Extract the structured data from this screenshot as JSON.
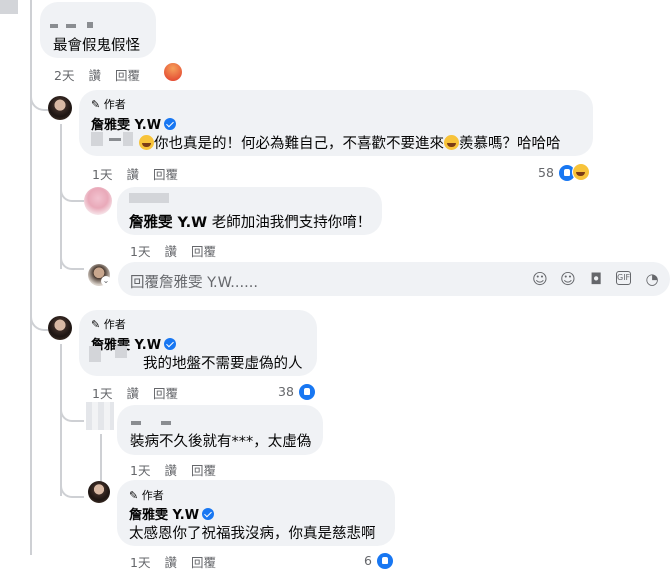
{
  "comment_root": {
    "text": "最會假鬼假怪",
    "actions": {
      "time": "2天",
      "like": "讚",
      "reply": "回覆"
    },
    "reaction": "angry-react-icon"
  },
  "reply1": {
    "author_badge": "作者",
    "name": "詹雅雯 Y.W",
    "text_a": "你也真是的！何必為難自己，不喜歡不要進來",
    "text_b": "羨慕嗎？哈哈哈",
    "actions": {
      "time": "1天",
      "like": "讚",
      "reply": "回覆"
    },
    "reaction_count": "58"
  },
  "reply1_sub": {
    "name": "詹雅雯 Y.W",
    "text": "老師加油我們支持你唷！",
    "actions": {
      "time": "1天",
      "like": "讚",
      "reply": "回覆"
    }
  },
  "reply_box": {
    "placeholder": "回覆詹雅雯 Y.W......",
    "icons": [
      "avatar-sticker-icon",
      "emoji-icon",
      "camera-icon",
      "gif-icon",
      "sticker-icon"
    ]
  },
  "reply2": {
    "author_badge": "作者",
    "name": "詹雅雯 Y.W",
    "text": "我的地盤不需要虛偽的人",
    "actions": {
      "time": "1天",
      "like": "讚",
      "reply": "回覆"
    },
    "reaction_count": "38"
  },
  "reply2_sub": {
    "text": "裝病不久後就有***，太虛偽",
    "actions": {
      "time": "1天",
      "like": "讚",
      "reply": "回覆"
    }
  },
  "reply2_sub_author": {
    "author_badge": "作者",
    "name": "詹雅雯 Y.W",
    "text": "太感恩你了祝福我沒病，你真是慈悲啊",
    "actions": {
      "time": "1天",
      "like": "讚",
      "reply": "回覆"
    },
    "reaction_count": "6"
  },
  "colors": {
    "link_gray": "#65676b",
    "bubble": "#f0f2f5",
    "brand_blue": "#1877f2",
    "thread_line": "#ced0d4"
  }
}
